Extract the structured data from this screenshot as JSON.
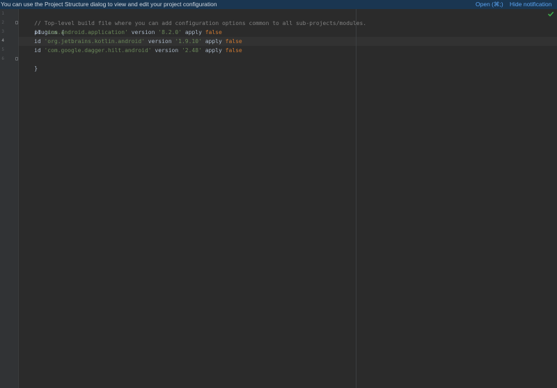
{
  "notification": {
    "message": "You can use the Project Structure dialog to view and edit your project configuration",
    "open_label": "Open (⌘;)",
    "hide_label": "Hide notification"
  },
  "gutter": {
    "line_numbers": [
      "1",
      "2",
      "3",
      "4",
      "5",
      "6"
    ],
    "active_line": "4"
  },
  "code": {
    "comment": "// Top-level build file where you can add configuration options common to all sub-projects/modules.",
    "plugins_open": "plugins {",
    "plugins_close": "}",
    "entries": [
      {
        "kw_id": "id",
        "id": "'com.android.application'",
        "kw_version": "version",
        "version": "'8.2.0'",
        "kw_apply": "apply",
        "apply": "false"
      },
      {
        "kw_id": "id",
        "id": "'org.jetbrains.kotlin.android'",
        "kw_version": "version",
        "version": "'1.9.10'",
        "kw_apply": "apply",
        "apply": "false"
      },
      {
        "kw_id": "id",
        "id": "'com.google.dagger.hilt.android'",
        "kw_version": "version",
        "version": "'2.48'",
        "kw_apply": "apply",
        "apply": "false"
      }
    ]
  },
  "icons": {
    "intention": "lightbulb-icon",
    "inspection": "check-icon"
  },
  "colors": {
    "comment": "#808080",
    "string": "#6a8759",
    "keyword": "#cc7832",
    "text": "#a9b7c6",
    "link": "#5aa3f0",
    "ok": "#3fae4a"
  }
}
